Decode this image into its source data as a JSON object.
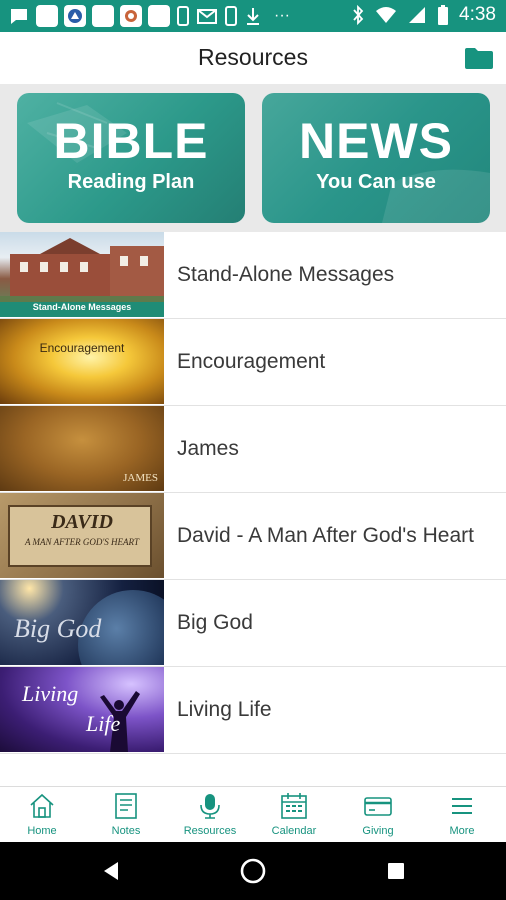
{
  "status_bar": {
    "time": "4:38"
  },
  "header": {
    "title": "Resources"
  },
  "banner": {
    "bible": {
      "title": "BIBLE",
      "subtitle": "Reading Plan"
    },
    "news": {
      "title": "NEWS",
      "subtitle": "You Can use"
    }
  },
  "resources": [
    {
      "label": "Stand-Alone Messages",
      "thumb_text": "Stand-Alone Messages"
    },
    {
      "label": "Encouragement",
      "thumb_text": "Encouragement"
    },
    {
      "label": "James",
      "thumb_text": "JAMES"
    },
    {
      "label": "David - A Man After God's Heart",
      "thumb_title": "DAVID",
      "thumb_sub": "A MAN AFTER GOD'S HEART"
    },
    {
      "label": "Big God",
      "thumb_text": "Big God"
    },
    {
      "label": "Living Life",
      "thumb_line1": "Living",
      "thumb_line2": "Life"
    }
  ],
  "tabs": [
    {
      "label": "Home",
      "icon": "home-icon"
    },
    {
      "label": "Notes",
      "icon": "notes-icon"
    },
    {
      "label": "Resources",
      "icon": "microphone-icon"
    },
    {
      "label": "Calendar",
      "icon": "calendar-icon"
    },
    {
      "label": "Giving",
      "icon": "credit-card-icon"
    },
    {
      "label": "More",
      "icon": "menu-icon"
    }
  ],
  "colors": {
    "accent": "#17937f",
    "status_bar": "#17937f",
    "banner_tile": "#2c998a"
  }
}
